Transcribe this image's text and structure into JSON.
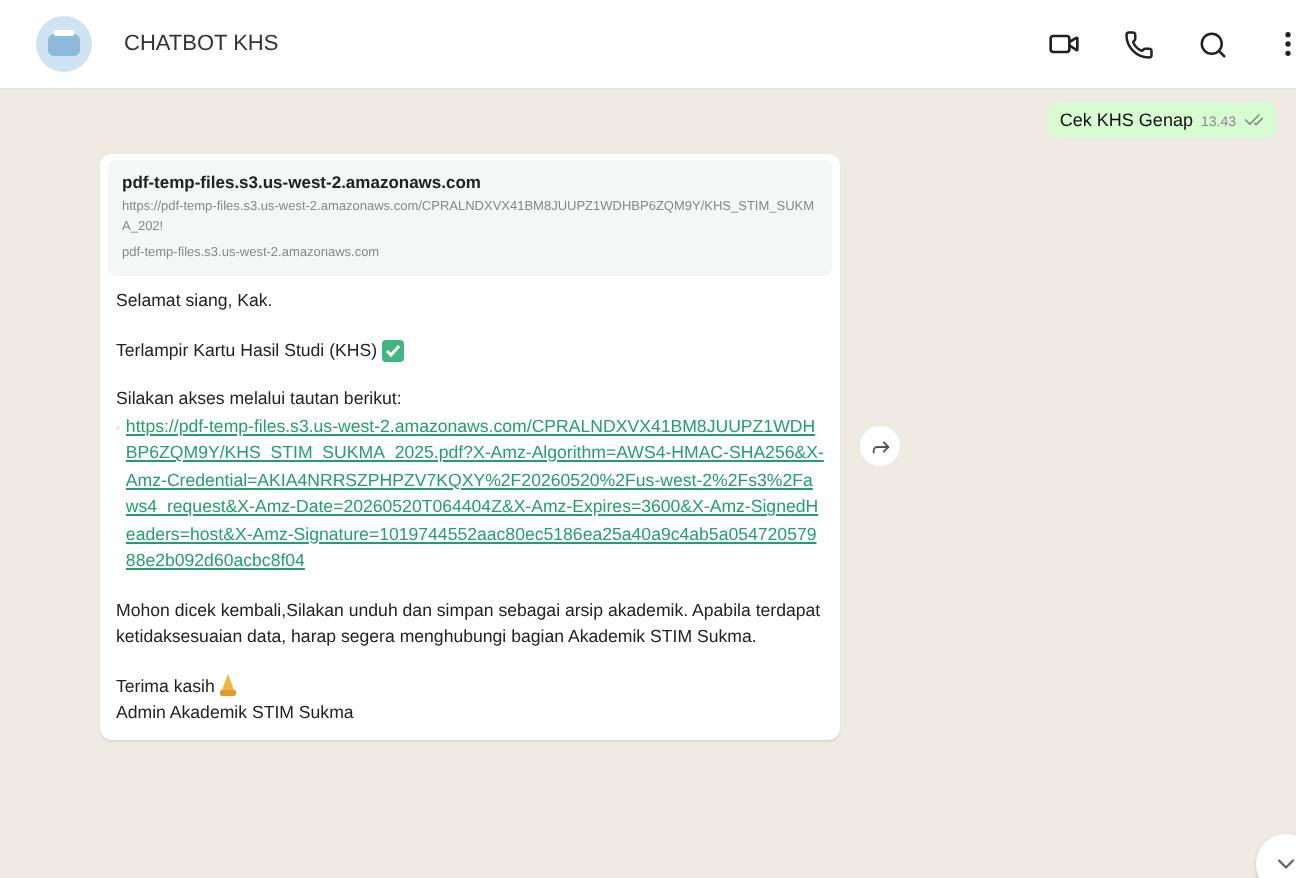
{
  "header": {
    "title": "CHATBOT KHS"
  },
  "outgoing": {
    "text": "Cek KHS Genap",
    "time": "13.43",
    "read": false
  },
  "incoming": {
    "preview": {
      "title": "pdf-temp-files.s3.us-west-2.amazonaws.com",
      "url": "https://pdf-temp-files.s3.us-west-2.amazonaws.com/CPRALNDXVX41BM8JUUPZ1WDHBP6ZQM9Y/KHS_STIM_SUKMA_202!",
      "domain": "pdf-temp-files.s3.us-west-2.amazonaws.com"
    },
    "greeting": "Selamat siang, Kak.",
    "attachment": "Terlampir Kartu Hasil Studi (KHS)",
    "access": "Silakan akses melalui tautan berikut:",
    "link": "https://pdf-temp-files.s3.us-west-2.amazonaws.com/CPRALNDXVX41BM8JUUPZ1WDHBP6ZQM9Y/KHS_STIM_SUKMA_2025.pdf?X-Amz-Algorithm=AWS4-HMAC-SHA256&X-Amz-Credential=AKIA4NRRSZPHPZV7KQXY%2F20260520%2Fus-west-2%2Fs3%2Faws4_request&X-Amz-Date=20260520T064404Z&X-Amz-Expires=3600&X-Amz-SignedHeaders=host&X-Amz-Signature=1019744552aac80ec5186ea25a40a9c4ab5a05472057988e2b092d60acbc8f04",
    "notice": "Mohon dicek kembali,Silakan unduh dan simpan sebagai arsip akademik. Apabila terdapat ketidaksesuaian data, harap segera menghubungi bagian Akademik STIM Sukma.",
    "thanks": "Terima kasih",
    "signature": "Admin Akademik STIM Sukma"
  }
}
